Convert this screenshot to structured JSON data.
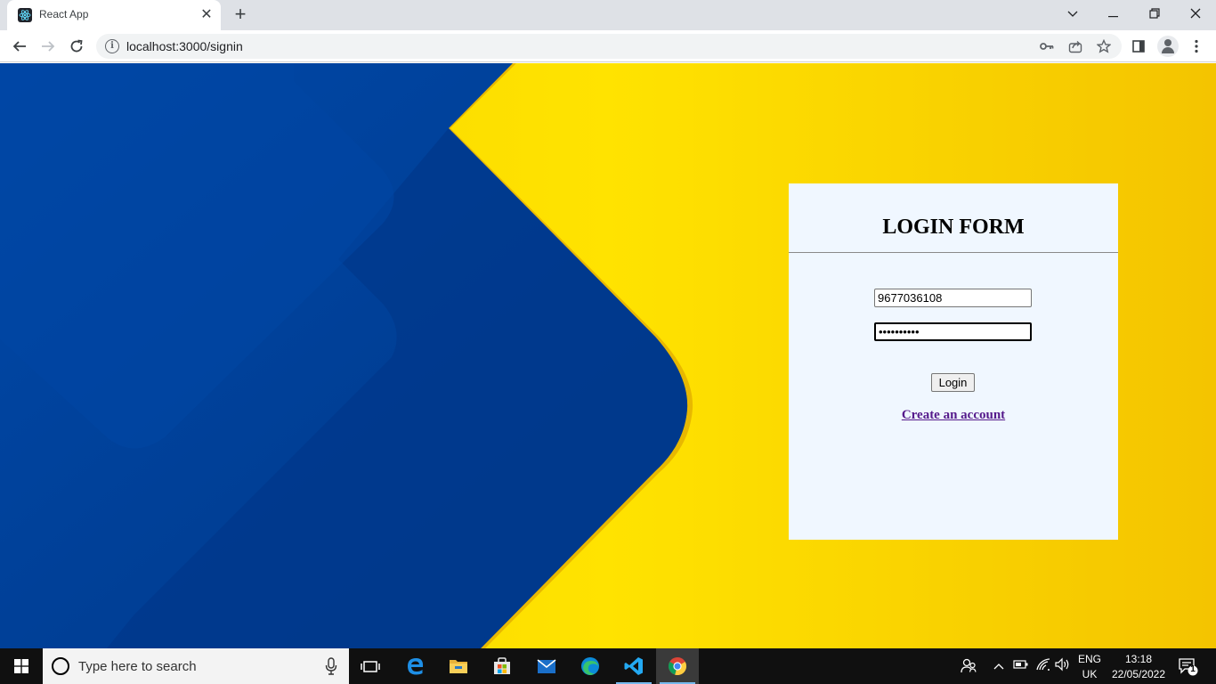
{
  "browser": {
    "tab_title": "React App",
    "tab_close": "✕",
    "new_tab": "+",
    "url": "localhost:3000/signin"
  },
  "login": {
    "title": "LOGIN FORM",
    "username_value": "9677036108",
    "password_value": "••••••••••",
    "button_label": "Login",
    "signup_link": "Create an account"
  },
  "taskbar": {
    "search_placeholder": "Type here to search",
    "language_top": "ENG",
    "language_bottom": "UK",
    "time": "13:18",
    "date": "22/05/2022",
    "notification_count": "1"
  },
  "colors": {
    "background_yellow": "#ffe300",
    "background_blue": "#003f96",
    "card_background": "#f0f7ff",
    "link_visited": "#551a8b"
  }
}
